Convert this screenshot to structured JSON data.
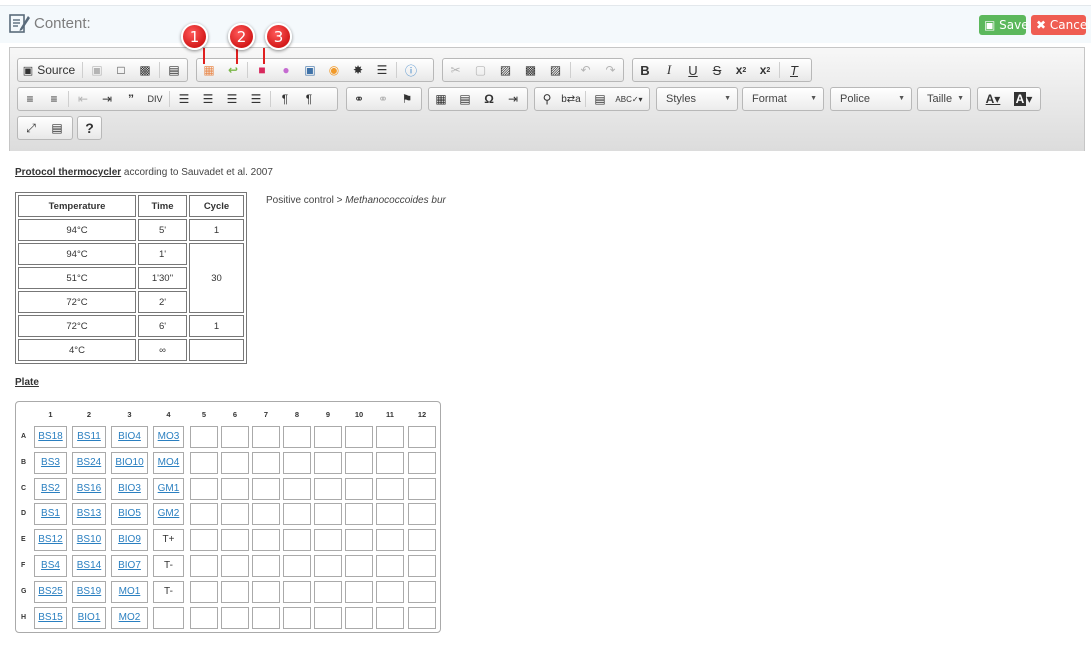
{
  "header": {
    "title": "Content:",
    "save_label": "Save",
    "cancel_label": "Cancel",
    "save_icon": "floppy-icon",
    "cancel_icon": "close-icon"
  },
  "toolbar": {
    "source_label": "Source",
    "dropdowns": [
      "Styles",
      "Format",
      "Police",
      "Taille"
    ],
    "help_label": "?"
  },
  "callouts": [
    "1",
    "2",
    "3"
  ],
  "protocol": {
    "heading_link": "Protocol thermocycler",
    "heading_rest": " according to Sauvadet et al. 2007",
    "columns": [
      "Temperature",
      "Time",
      "Cycle"
    ],
    "rows": [
      [
        "94°C",
        "5'",
        "1"
      ],
      [
        "94°C",
        "1'",
        "30"
      ],
      [
        "51°C",
        "1'30''"
      ],
      [
        "72°C",
        "2'"
      ],
      [
        "72°C",
        "6'",
        "1"
      ],
      [
        "4°C",
        "∞",
        ""
      ]
    ],
    "note_prefix": "Positive control > ",
    "note_species": "Methanococcoides bur"
  },
  "plate": {
    "heading": "Plate",
    "columns": [
      "1",
      "2",
      "3",
      "4",
      "5",
      "6",
      "7",
      "8",
      "9",
      "10",
      "11",
      "12"
    ],
    "rows": [
      "A",
      "B",
      "C",
      "D",
      "E",
      "F",
      "G",
      "H"
    ],
    "cells": [
      [
        "BS18",
        "BS11",
        "BIO4",
        "MO3"
      ],
      [
        "BS3",
        "BS24",
        "BIO10",
        "MO4"
      ],
      [
        "BS2",
        "BS16",
        "BIO3",
        "GM1"
      ],
      [
        "BS1",
        "BS13",
        "BIO5",
        "GM2"
      ],
      [
        "BS12",
        "BS10",
        "BIO9",
        "T+"
      ],
      [
        "BS4",
        "BS14",
        "BIO7",
        "T-"
      ],
      [
        "BS25",
        "BS19",
        "MO1",
        "T-"
      ],
      [
        "BS15",
        "BIO1",
        "MO2",
        ""
      ]
    ],
    "plain_cells": [
      "T+",
      "T-"
    ]
  }
}
